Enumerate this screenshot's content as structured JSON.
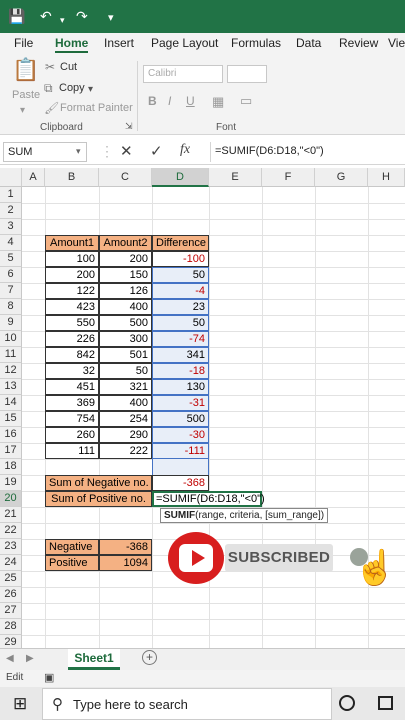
{
  "ribbon_tabs": [
    "File",
    "Home",
    "Insert",
    "Page Layout",
    "Formulas",
    "Data",
    "Review",
    "Vie"
  ],
  "clipboard": {
    "paste": "Paste",
    "cut": "Cut",
    "copy": "Copy",
    "format_painter": "Format Painter",
    "group": "Clipboard"
  },
  "font": {
    "name": "Calibri",
    "group": "Font"
  },
  "name_box": "SUM",
  "formula": "=SUMIF(D6:D18,\"<0\")",
  "columns": [
    "A",
    "B",
    "C",
    "D",
    "E",
    "F",
    "G",
    "H"
  ],
  "rows": [
    "1",
    "2",
    "3",
    "4",
    "5",
    "6",
    "7",
    "8",
    "9",
    "10",
    "11",
    "12",
    "13",
    "14",
    "15",
    "16",
    "17",
    "18",
    "19",
    "20",
    "21",
    "22",
    "23",
    "24",
    "25",
    "26",
    "27",
    "28",
    "29"
  ],
  "table": {
    "headers": [
      "Amount1",
      "Amount2",
      "Difference"
    ],
    "rows": [
      [
        "100",
        "200",
        "-100"
      ],
      [
        "200",
        "150",
        "50"
      ],
      [
        "122",
        "126",
        "-4"
      ],
      [
        "423",
        "400",
        "23"
      ],
      [
        "550",
        "500",
        "50"
      ],
      [
        "226",
        "300",
        "-74"
      ],
      [
        "842",
        "501",
        "341"
      ],
      [
        "32",
        "50",
        "-18"
      ],
      [
        "451",
        "321",
        "130"
      ],
      [
        "369",
        "400",
        "-31"
      ],
      [
        "754",
        "254",
        "500"
      ],
      [
        "260",
        "290",
        "-30"
      ],
      [
        "111",
        "222",
        "-111"
      ]
    ]
  },
  "sums": {
    "neg_label": "Sum of Negative no.",
    "neg_value": "-368",
    "pos_label": "Sum of Positive no.",
    "pos_formula": "=SUMIF(D6:D18,\"<0\")"
  },
  "tooltip": {
    "fn": "SUMIF",
    "args": "(range, criteria, [sum_range])"
  },
  "summary": [
    [
      "Negative",
      "-368"
    ],
    [
      "Positive",
      "1094"
    ]
  ],
  "overlay": {
    "subscribed": "SUBSCRIBED"
  },
  "sheet": {
    "tab": "Sheet1",
    "add": "+"
  },
  "status": {
    "mode": "Edit"
  },
  "taskbar": {
    "search": "Type here to search"
  }
}
